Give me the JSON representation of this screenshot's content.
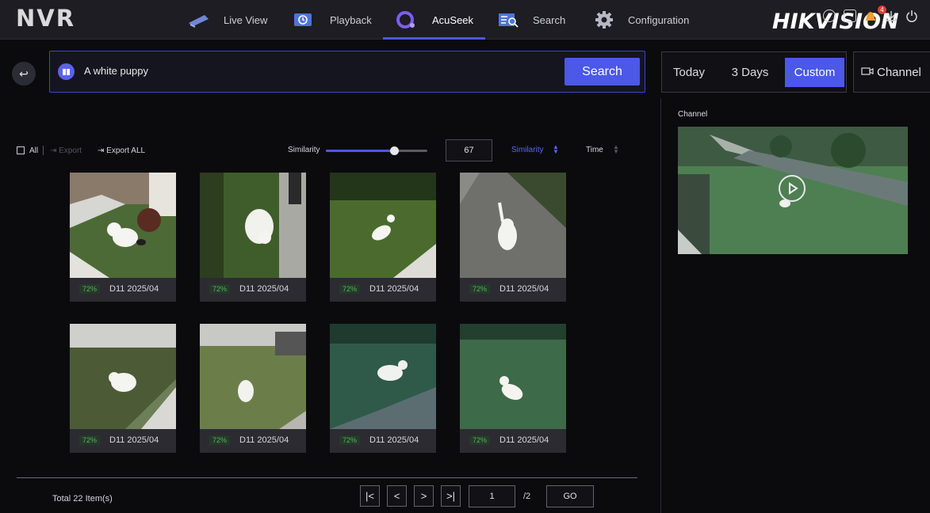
{
  "app": {
    "logo": "NVR",
    "brand": "HIKVISION"
  },
  "nav": [
    {
      "label": "Live View",
      "icon": "camera-icon"
    },
    {
      "label": "Playback",
      "icon": "playback-icon"
    },
    {
      "label": "AcuSeek",
      "icon": "acuseek-icon",
      "active": true
    },
    {
      "label": "Search",
      "icon": "search-list-icon"
    },
    {
      "label": "Configuration",
      "icon": "gear-icon"
    }
  ],
  "top_icons": [
    "info-icon",
    "camera-capture-icon",
    "alarm-bell-icon",
    "download-icon",
    "power-icon"
  ],
  "notification_count": "4",
  "search": {
    "query": "A white puppy",
    "button": "Search"
  },
  "toolbar": {
    "all": "All",
    "export": "Export",
    "export_all": "Export ALL",
    "similarity_label": "Similarity",
    "similarity_value": "67",
    "sort_similarity": "Similarity",
    "sort_time": "Time"
  },
  "results": [
    {
      "similarity": "72%",
      "label": "D11  2025/04"
    },
    {
      "similarity": "72%",
      "label": "D11  2025/04"
    },
    {
      "similarity": "72%",
      "label": "D11  2025/04"
    },
    {
      "similarity": "72%",
      "label": "D11  2025/04"
    },
    {
      "similarity": "72%",
      "label": "D11  2025/04"
    },
    {
      "similarity": "72%",
      "label": "D11  2025/04"
    },
    {
      "similarity": "72%",
      "label": "D11  2025/04"
    },
    {
      "similarity": "72%",
      "label": "D11  2025/04"
    }
  ],
  "pagination": {
    "total": "Total 22 Item(s)",
    "page": "1",
    "page_total": "/2",
    "go": "GO"
  },
  "right": {
    "tabs": [
      "Today",
      "3 Days",
      "Custom"
    ],
    "selected_tab": "Custom",
    "channel_button": "Channel",
    "channel_label": "Channel"
  },
  "colors": {
    "accent": "#4b58e8",
    "similarity_green": "#4bb65c"
  }
}
